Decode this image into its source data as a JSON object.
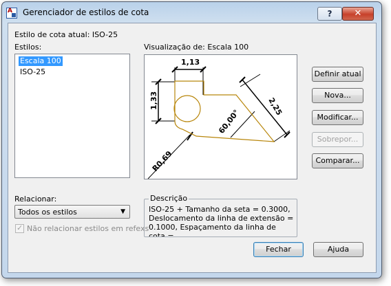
{
  "window": {
    "title": "Gerenciador de estilos de cota",
    "help_label": "?",
    "close_label": "✕"
  },
  "current_style": {
    "label": "Estilo de cota atual: ISO-25"
  },
  "styles": {
    "label": "Estilos:",
    "items": [
      {
        "label": "Escala 100",
        "selected": true
      },
      {
        "label": "ISO-25",
        "selected": false
      }
    ]
  },
  "preview": {
    "label": "Visualização de: Escala 100",
    "dims": {
      "top": "1,13",
      "left": "1,33",
      "diagonal": "2,25",
      "angle": "60,00°",
      "radius": "R0,69"
    }
  },
  "description": {
    "label": "Descrição",
    "lines": [
      "ISO-25 + Tamanho da seta = 0.3000,",
      "Deslocamento da linha de extensão =",
      "0.1000, Espaçamento da linha de cota ="
    ]
  },
  "list_filter": {
    "label": "Relacionar:",
    "value": "Todos os estilos"
  },
  "xref_checkbox": {
    "label": "Não relacionar estilos em refexs",
    "checked": true,
    "disabled": true
  },
  "buttons": {
    "set_current": "Definir atual",
    "new": "Nova...",
    "modify": "Modificar...",
    "override": "Sobrepor...",
    "compare": "Comparar...",
    "close": "Fechar",
    "help": "Ajuda"
  },
  "colors": {
    "selection": "#3399ff",
    "geometry": "#b8860b"
  }
}
